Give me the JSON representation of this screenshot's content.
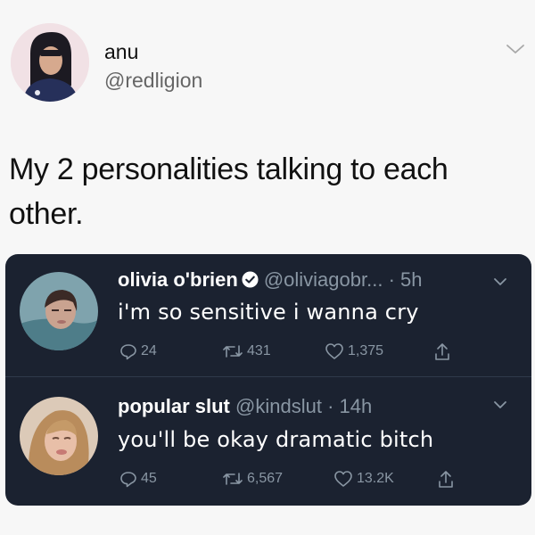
{
  "post": {
    "author_name": "anu",
    "author_handle": "@redligion",
    "text": "My 2 personalities talking to each other."
  },
  "tweets": [
    {
      "name": "olivia o'brien",
      "verified": true,
      "handle": "@oliviagobr...",
      "time": "· 5h",
      "text": "i'm so sensitive i wanna cry",
      "replies": "24",
      "retweets": "431",
      "likes": "1,375"
    },
    {
      "name": "popular slut",
      "verified": false,
      "handle": "@kindslut",
      "time": "· 14h",
      "text": "you'll be okay dramatic bitch",
      "replies": "45",
      "retweets": "6,567",
      "likes": "13.2K"
    }
  ],
  "colors": {
    "embed_bg": "#1b2230",
    "muted": "#8996a3",
    "verified": "#1da1f2"
  },
  "icons": [
    "chevron-down-icon",
    "verified-badge-icon",
    "reply-icon",
    "retweet-icon",
    "like-icon",
    "share-icon"
  ]
}
